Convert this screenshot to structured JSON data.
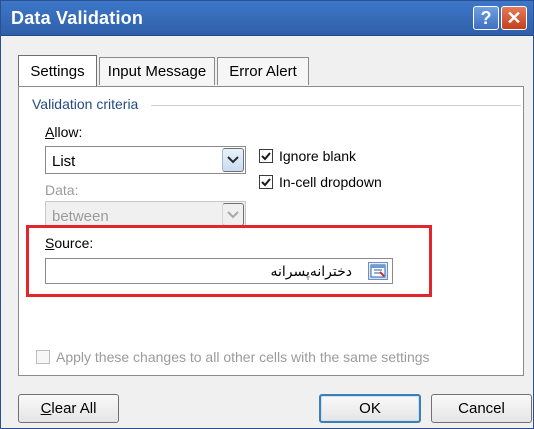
{
  "window": {
    "title": "Data Validation",
    "help_glyph": "?",
    "close_glyph": "✕"
  },
  "tabs": [
    {
      "label": "Settings",
      "active": true
    },
    {
      "label": "Input Message",
      "active": false
    },
    {
      "label": "Error Alert",
      "active": false
    }
  ],
  "criteria": {
    "group_title": "Validation criteria",
    "allow_label": "Allow:",
    "allow_value": "List",
    "data_label": "Data:",
    "data_value": "between",
    "ignore_blank_label": "Ignore blank",
    "in_cell_dropdown_label": "In-cell dropdown"
  },
  "source": {
    "label": "Source:",
    "value": "دختر‌انه‌پسرانه"
  },
  "apply_all": {
    "label": "Apply these changes to all other cells with the same settings"
  },
  "buttons": {
    "clear_all": "Clear All",
    "ok": "OK",
    "cancel": "Cancel"
  },
  "colors": {
    "title_bar": "#2f5fa9",
    "highlight_frame": "#e2262b",
    "group_title": "#244a86"
  }
}
